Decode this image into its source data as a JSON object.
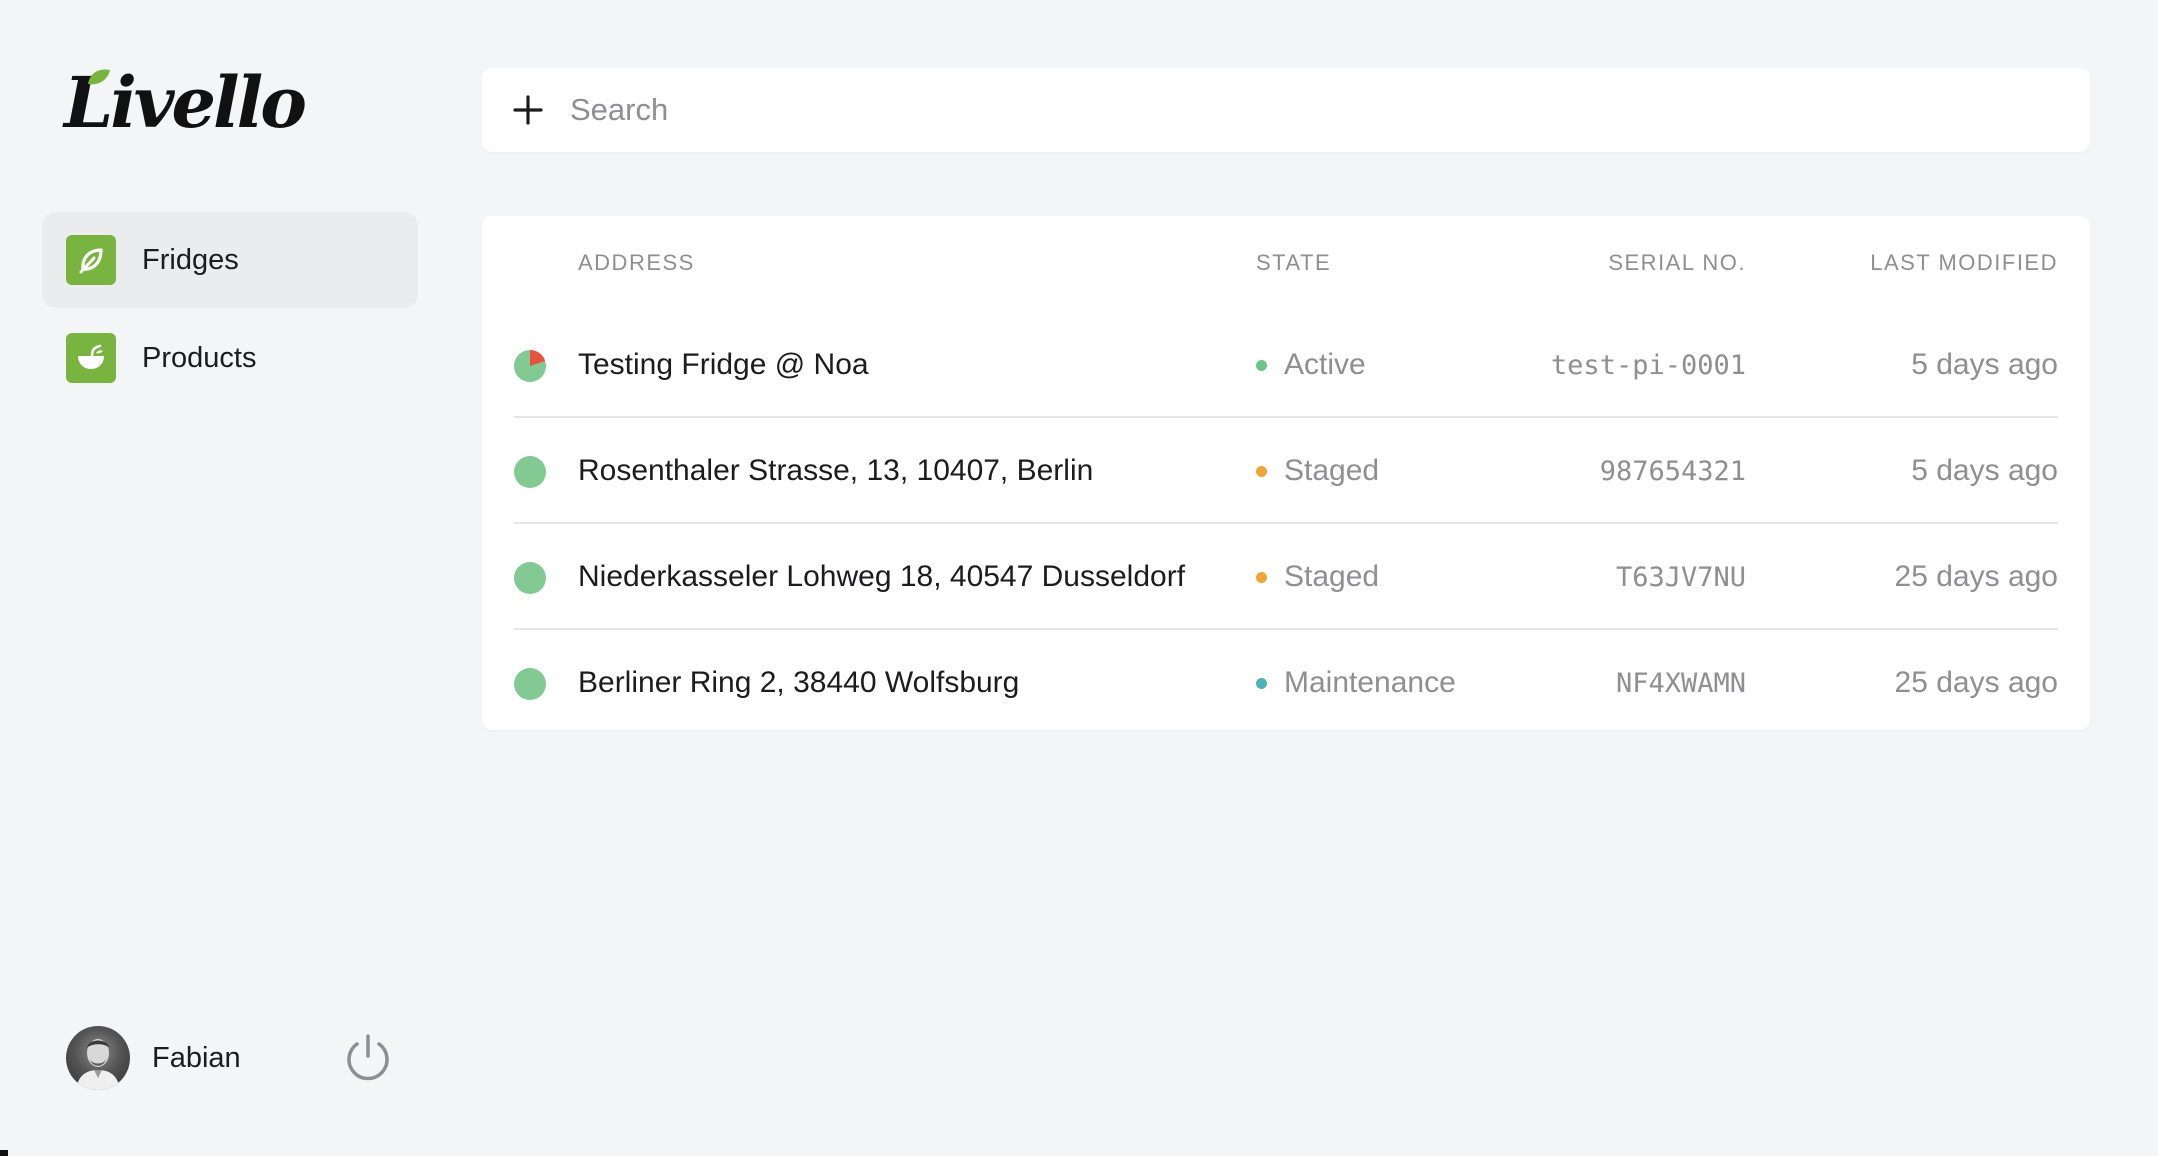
{
  "brand": {
    "logo_text": "Livello",
    "accent": "#79b441",
    "leaf_color": "#79b441"
  },
  "sidebar": {
    "items": [
      {
        "label": "Fridges",
        "icon": "leaf-icon",
        "active": true
      },
      {
        "label": "Products",
        "icon": "bowl-icon",
        "active": false
      }
    ]
  },
  "user": {
    "name": "Fabian",
    "avatar_icon": "avatar-photo",
    "logout_icon": "power-icon"
  },
  "search": {
    "placeholder": "Search",
    "value": "",
    "add_icon": "plus-icon"
  },
  "table": {
    "headers": {
      "address": "ADDRESS",
      "state": "STATE",
      "serial": "SERIAL NO.",
      "modified": "LAST MODIFIED"
    },
    "rows": [
      {
        "address": "Testing Fridge @ Noa",
        "state": "Active",
        "state_color": "#6cc48b",
        "serial": "test-pi-0001",
        "modified": "5 days ago",
        "marker": "pie-warning",
        "marker_color": "#83c994",
        "alert_color": "#e5533d"
      },
      {
        "address": "Rosenthaler Strasse, 13, 10407, Berlin",
        "state": "Staged",
        "state_color": "#f0a43a",
        "serial": "987654321",
        "modified": "5 days ago",
        "marker": "ok",
        "marker_color": "#83c994"
      },
      {
        "address": "Niederkasseler Lohweg 18, 40547 Dusseldorf",
        "state": "Staged",
        "state_color": "#f0a43a",
        "serial": "T63JV7NU",
        "modified": "25 days ago",
        "marker": "ok",
        "marker_color": "#83c994"
      },
      {
        "address": "Berliner Ring 2, 38440 Wolfsburg",
        "state": "Maintenance",
        "state_color": "#4fb1b8",
        "serial": "NF4XWAMN",
        "modified": "25 days ago",
        "marker": "ok",
        "marker_color": "#83c994"
      }
    ]
  }
}
